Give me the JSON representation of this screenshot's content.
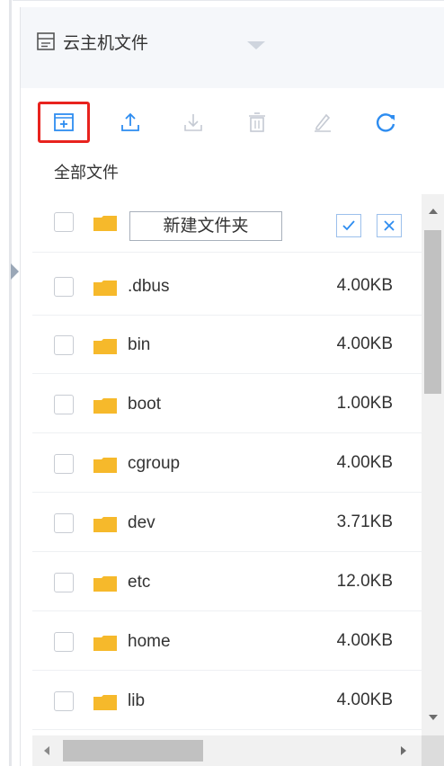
{
  "header": {
    "tab_label": "云主机文件",
    "tab_icon": "server-file-icon"
  },
  "toolbar": {
    "buttons": [
      {
        "name": "new-folder",
        "icon": "new-folder-icon",
        "enabled": true
      },
      {
        "name": "upload",
        "icon": "upload-icon",
        "enabled": true
      },
      {
        "name": "download",
        "icon": "download-icon",
        "enabled": false
      },
      {
        "name": "delete",
        "icon": "trash-icon",
        "enabled": false
      },
      {
        "name": "rename",
        "icon": "pencil-icon",
        "enabled": false
      },
      {
        "name": "refresh",
        "icon": "refresh-icon",
        "enabled": true
      }
    ],
    "highlighted": "new-folder"
  },
  "path": {
    "label": "全部文件"
  },
  "new_folder_row": {
    "input_value": "新建文件夹",
    "confirm_icon": "check-icon",
    "cancel_icon": "close-icon"
  },
  "files": [
    {
      "name": ".dbus",
      "size": "4.00KB"
    },
    {
      "name": "bin",
      "size": "4.00KB"
    },
    {
      "name": "boot",
      "size": "1.00KB"
    },
    {
      "name": "cgroup",
      "size": "4.00KB"
    },
    {
      "name": "dev",
      "size": "3.71KB"
    },
    {
      "name": "etc",
      "size": "12.0KB"
    },
    {
      "name": "home",
      "size": "4.00KB"
    },
    {
      "name": "lib",
      "size": "4.00KB"
    }
  ],
  "colors": {
    "accent_blue": "#2d8cf0",
    "disabled_gray": "#c5cad3",
    "folder_yellow": "#f6b92b",
    "highlight_red": "#e8231e"
  }
}
